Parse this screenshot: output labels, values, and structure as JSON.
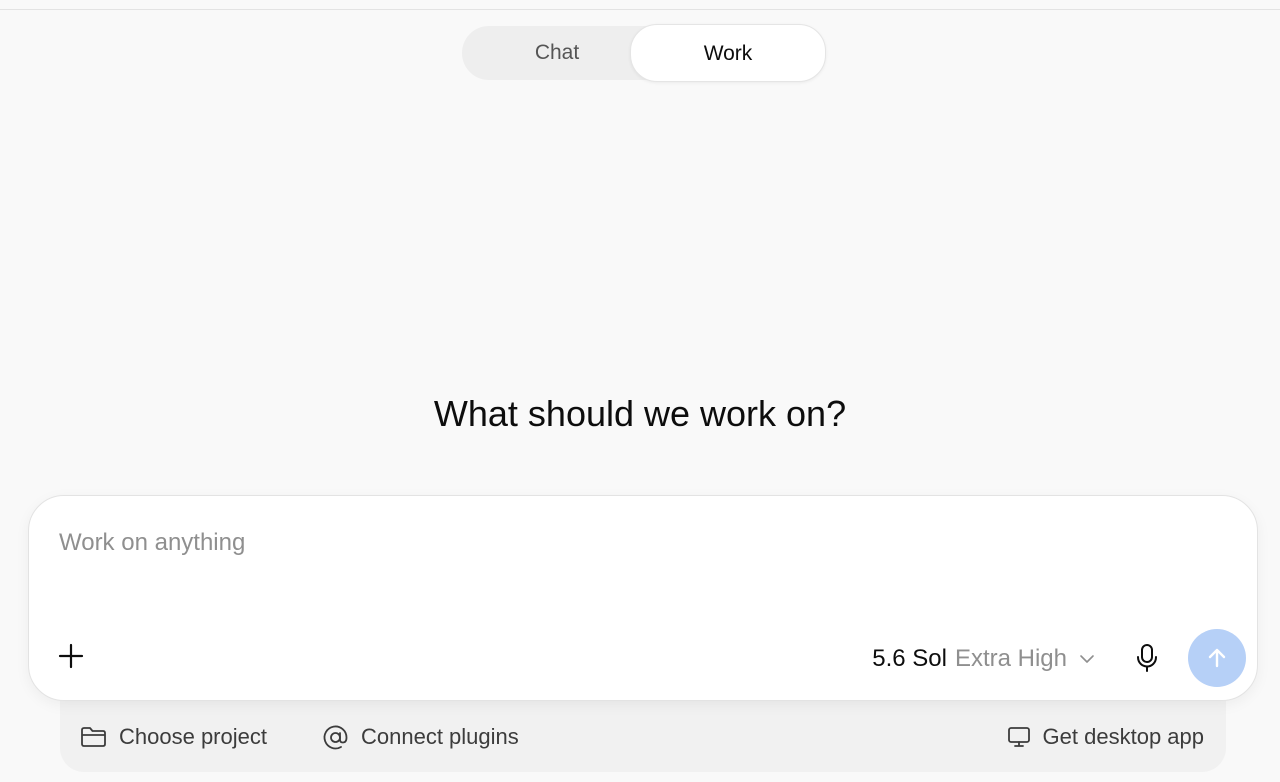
{
  "mode_toggle": {
    "chat_label": "Chat",
    "work_label": "Work",
    "active": "Work"
  },
  "headline": "What should we work on?",
  "composer": {
    "placeholder": "Work on anything",
    "value": "",
    "model_name": "5.6 Sol",
    "model_effort": "Extra High",
    "send_button_color": "#b6d0f7"
  },
  "footer": {
    "choose_project_label": "Choose project",
    "connect_plugins_label": "Connect plugins",
    "get_desktop_app_label": "Get desktop app"
  },
  "icons": {
    "plus": "plus-icon",
    "chevron": "chevron-down-icon",
    "mic": "microphone-icon",
    "send": "arrow-up-icon",
    "folder": "folder-icon",
    "at": "at-sign-icon",
    "monitor": "monitor-icon"
  }
}
